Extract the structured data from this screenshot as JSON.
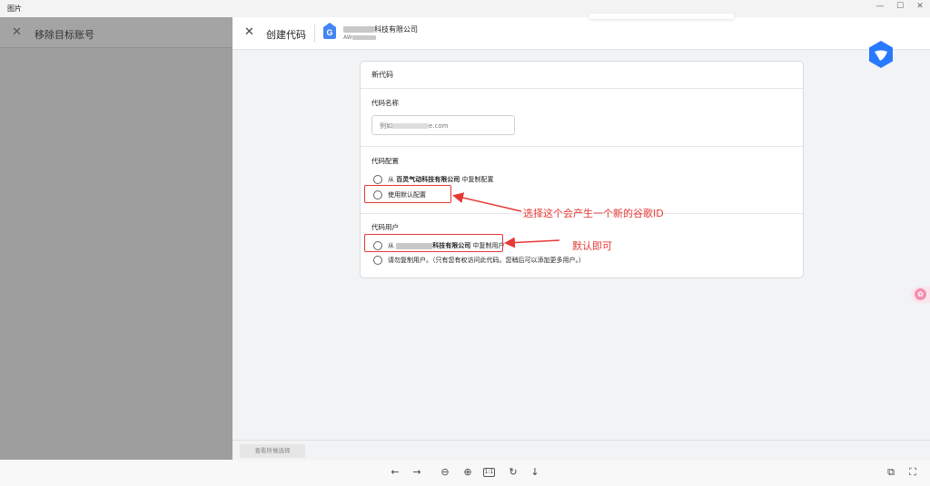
{
  "window": {
    "title": "图片",
    "minimize": "—",
    "maximize": "☐",
    "close": "✕"
  },
  "left_panel": {
    "close_icon": "✕",
    "title": "移除目标账号"
  },
  "header": {
    "close_icon": "✕",
    "title": "创建代码",
    "tag_icon_letter": "G",
    "account_name_suffix": "科技有限公司",
    "account_id_prefix": "AW"
  },
  "form": {
    "card_title": "新代码",
    "name_section": {
      "label": "代码名称",
      "placeholder_prefix": "例如",
      "placeholder_suffix": "e.com"
    },
    "config_section": {
      "label": "代码配置",
      "option1_prefix": "从",
      "option1_company": "百灵气动科技有限公司",
      "option1_suffix": "中复制配置",
      "option2": "使用默认配置"
    },
    "users_section": {
      "label": "代码用户",
      "option1_prefix": "从",
      "option1_company_suffix": "科技有限公司",
      "option1_suffix": "中复制用户",
      "option2": "请勿复制用户。（只有您有权访问此代码。您稍后可以添加更多用户。）"
    }
  },
  "annotations": {
    "note1": "选择这个会产生一个新的谷歌ID",
    "note2": "默认即可",
    "color": "#e53935"
  },
  "footer": {
    "button": "查看所做选择"
  },
  "toolbar": {
    "prev": "←",
    "next": "→",
    "zoom_out": "⊖",
    "zoom_in": "⊕",
    "actual_size": "1:1",
    "rotate": "↻",
    "download": "↓",
    "fit": "⛶",
    "crop": "⧉"
  },
  "side_widget": {
    "label": "✿"
  }
}
